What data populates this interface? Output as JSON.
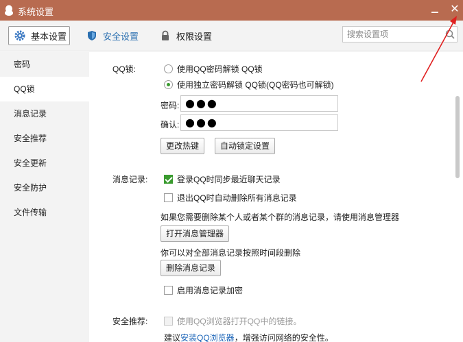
{
  "window": {
    "title": "系统设置",
    "minimize_icon": "minimize-icon",
    "close_icon": "close-icon"
  },
  "toolbar": {
    "tabs": [
      {
        "label": "基本设置",
        "icon": "gear-icon"
      },
      {
        "label": "安全设置",
        "icon": "shield-icon"
      },
      {
        "label": "权限设置",
        "icon": "lock-icon"
      }
    ],
    "search_placeholder": "搜索设置项"
  },
  "sidebar": {
    "items": [
      {
        "label": "密码"
      },
      {
        "label": "QQ锁"
      },
      {
        "label": "消息记录"
      },
      {
        "label": "安全推荐"
      },
      {
        "label": "安全更新"
      },
      {
        "label": "安全防护"
      },
      {
        "label": "文件传输"
      }
    ],
    "active_index": 1
  },
  "qqlock": {
    "label": "QQ锁:",
    "option_qq_password": "使用QQ密码解锁 QQ锁",
    "option_independent": "使用独立密码解锁 QQ锁(QQ密码也可解锁)",
    "password_label": "密码:",
    "password_value": "●●●",
    "confirm_label": "确认:",
    "confirm_value": "●●●",
    "change_hotkey_button": "更改热键",
    "auto_lock_button": "自动锁定设置"
  },
  "msglog": {
    "label": "消息记录:",
    "sync_label": "登录QQ时同步最近聊天记录",
    "sync_checked": true,
    "delete_on_exit_label": "退出QQ时自动删除所有消息记录",
    "delete_on_exit_checked": false,
    "manager_hint": "如果您需要删除某个人或者某个群的消息记录，请使用消息管理器",
    "open_manager_button": "打开消息管理器",
    "delete_hint": "你可以对全部消息记录按照时间段删除",
    "delete_button": "删除消息记录",
    "encrypt_label": "启用消息记录加密",
    "encrypt_checked": false
  },
  "recommend": {
    "label": "安全推荐:",
    "browser_label": "使用QQ浏览器打开QQ中的链接。",
    "suggest_prefix": "建议",
    "suggest_link": "安装QQ浏览器",
    "suggest_suffix": "，增强访问网络的安全性。"
  },
  "colors": {
    "titlebar": "#b86b50",
    "accent_green": "#3a9b2f",
    "link": "#1a64b8",
    "annotation_arrow": "#e02020"
  }
}
